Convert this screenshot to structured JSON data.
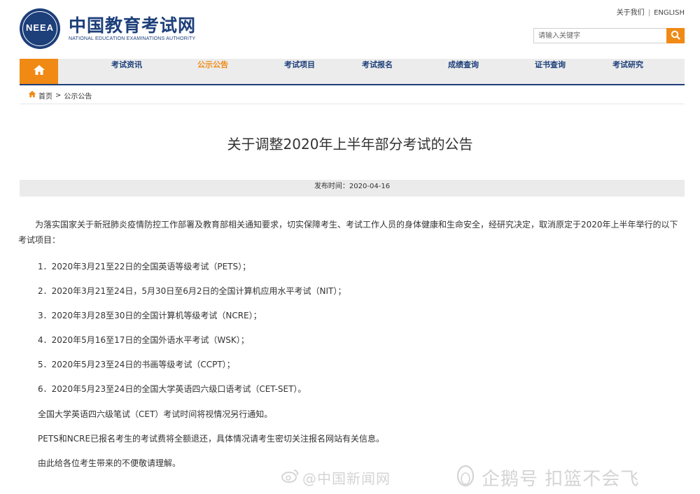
{
  "header": {
    "logo_seal_text": "NEEA",
    "logo_cn": "中国教育考试网",
    "logo_en": "NATIONAL EDUCATION EXAMINATIONS AUTHORITY",
    "about_link": "关于我们",
    "separator": "|",
    "english_link": "ENGLISH",
    "search_placeholder": "请输入关键字",
    "search_icon": "search-icon"
  },
  "nav": {
    "home_icon": "home-icon",
    "items": [
      {
        "label": "考试资讯"
      },
      {
        "label": "公示公告",
        "active": true
      },
      {
        "label": "考试项目"
      },
      {
        "label": "考试报名"
      },
      {
        "label": "成绩查询"
      },
      {
        "label": "证书查询"
      },
      {
        "label": "考试研究"
      }
    ],
    "accent_color": "#f08a15",
    "brand_color": "#1d3f7a"
  },
  "breadcrumb": {
    "home": "首页",
    "gt": ">",
    "current": "公示公告"
  },
  "article": {
    "title": "关于调整2020年上半年部分考试的公告",
    "publish_time": "发布时间：2020-04-16",
    "intro": "为落实国家关于新冠肺炎疫情防控工作部署及教育部相关通知要求，切实保障考生、考试工作人员的身体健康和生命安全，经研究决定，取消原定于2020年上半年举行的以下考试项目：",
    "items": [
      "1．2020年3月21至22日的全国英语等级考试（PETS）；",
      "2．2020年3月21至24日，5月30日至6月2日的全国计算机应用水平考试（NIT）；",
      "3．2020年3月28至30日的全国计算机等级考试（NCRE）；",
      "4．2020年5月16至17日的全国外语水平考试（WSK）；",
      "5．2020年5月23至24日的书画等级考试（CCPT）；",
      "6．2020年5月23至24日的全国大学英语四六级口语考试（CET-SET）。"
    ],
    "notes": [
      "全国大学英语四六级笔试（CET）考试时间将视情况另行通知。",
      "PETS和NCRE已报名考生的考试费将全额退还，具体情况请考生密切关注报名网站有关信息。",
      "由此给各位考生带来的不便敬请理解。"
    ]
  },
  "watermark": {
    "left": "@中国新闻网",
    "right": "企鹅号 扣篮不会飞"
  }
}
